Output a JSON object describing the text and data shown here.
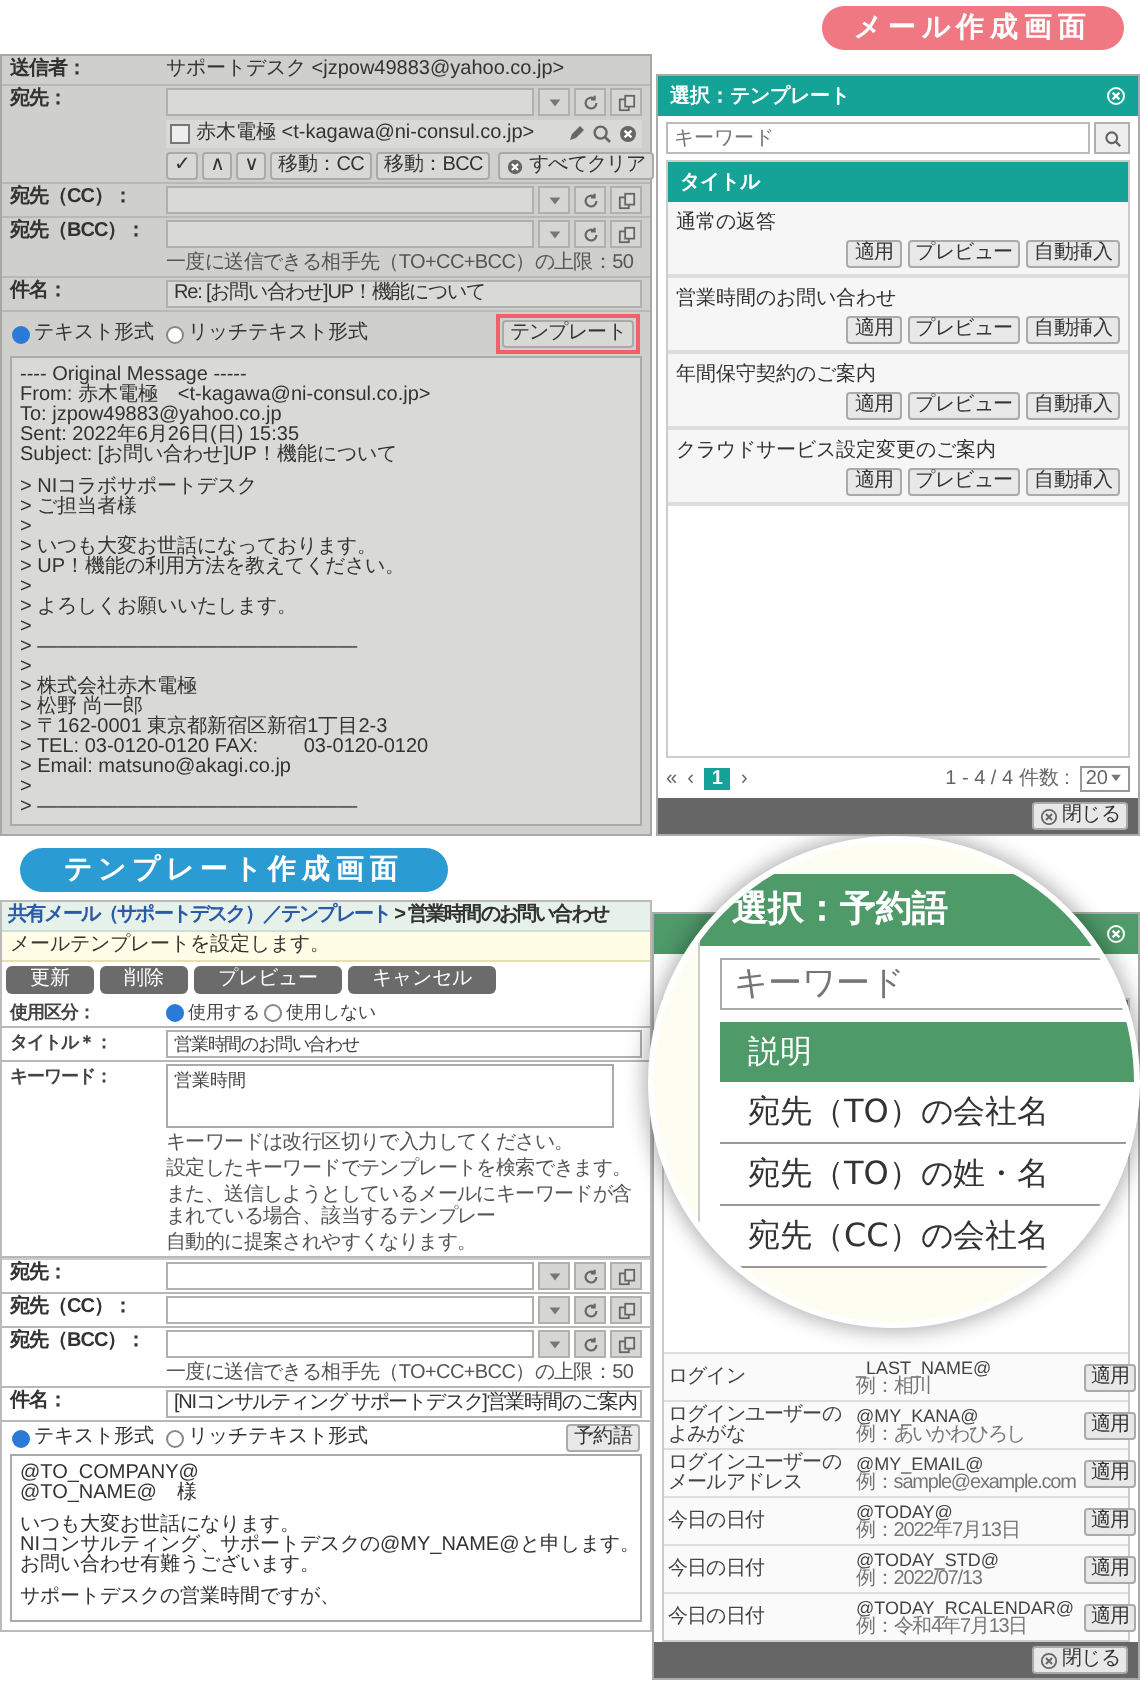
{
  "mail_screen": {
    "badge": "メール作成画面",
    "compose": {
      "sender_label": "送信者：",
      "sender": "サポートデスク <jzpow49883@yahoo.co.jp>",
      "to_label": "宛先：",
      "contact": {
        "checked": false,
        "text": "赤木電極 <t-kagawa@ni-consul.co.jp>"
      },
      "recipient_buttons": [
        "✓",
        "∧",
        "∨",
        "移動：CC",
        "移動：BCC"
      ],
      "clear_all": "すべてクリア",
      "cc_label": "宛先（CC）：",
      "bcc_label": "宛先（BCC）：",
      "limit_note": "一度に送信できる相手先（TO+CC+BCC）の上限：50",
      "subject_label": "件名：",
      "subject": "Re: [お問い合わせ]UP！機能について",
      "formats": [
        {
          "label": "テキスト形式",
          "selected": true
        },
        {
          "label": "リッチテキスト形式",
          "selected": false
        }
      ],
      "template_button": {
        "label": "テンプレート",
        "highlighted": true
      },
      "body": [
        [
          "---- Original Message -----",
          "From: 赤木電極　<t-kagawa@ni-consul.co.jp>",
          "To: jzpow49883@yahoo.co.jp",
          "Sent: 2022年6月26日(日) 15:35",
          "Subject: [お問い合わせ]UP！機能について"
        ],
        [
          "> NIコラボサポートデスク",
          "> ご担当者様",
          ">",
          "> いつも大変お世話になっております。",
          "> UP！機能の利用方法を教えてください。",
          ">",
          "> よろしくお願いいたします。",
          ">",
          "> ――――――――――――――――",
          ">",
          "> 株式会社赤木電極",
          "> 松野 尚一郎",
          "> 〒162-0001 東京都新宿区新宿1丁目2-3",
          "> TEL: 03-0120-0120 FAX:　　 03-0120-0120",
          "> Email: matsuno@akagi.co.jp",
          ">",
          "> ――――――――――――――――"
        ]
      ]
    },
    "template_dialog": {
      "title": "選択：テンプレート",
      "search_placeholder": "キーワード",
      "column": "タイトル",
      "rows": [
        {
          "title": "通常の返答",
          "actions": [
            "適用",
            "プレビュー",
            "自動挿入"
          ]
        },
        {
          "title": "営業時間のお問い合わせ",
          "actions": [
            "適用",
            "プレビュー",
            "自動挿入"
          ]
        },
        {
          "title": "年間保守契約のご案内",
          "actions": [
            "適用",
            "プレビュー",
            "自動挿入"
          ]
        },
        {
          "title": "クラウドサービス設定変更のご案内",
          "actions": [
            "適用",
            "プレビュー",
            "自動挿入"
          ]
        }
      ],
      "pager": {
        "first": "«",
        "prev": "‹",
        "pages": [
          {
            "label": "1",
            "selected": true
          }
        ],
        "next": "›",
        "summary": "1 - 4 / 4 件数 :",
        "per_page": "20"
      },
      "close": "閉じる"
    }
  },
  "template_screen": {
    "badge": "テンプレート作成画面",
    "form": {
      "breadcrumb_link": "共有メール（サポートデスク）／テンプレート",
      "breadcrumb_current": "> 営業時間のお問い合わせ",
      "description": "メールテンプレートを設定します。",
      "buttons": [
        "更新",
        "削除",
        "プレビュー",
        "キャンセル"
      ],
      "usage_label": "使用区分：",
      "usage_options": [
        {
          "label": "使用する",
          "selected": true
        },
        {
          "label": "使用しない",
          "selected": false
        }
      ],
      "title_label": "タイトル＊：",
      "title": "営業時間のお問い合わせ",
      "keyword_label": "キーワード：",
      "keyword": "営業時間",
      "keyword_notes": [
        "キーワードは改行区切りで入力してください。",
        "設定したキーワードでテンプレートを検索できます。",
        "また、送信しようとしているメールにキーワードが含まれている場合、該当するテンプレー",
        "自動的に提案されやすくなります。"
      ],
      "to_label": "宛先：",
      "cc_label": "宛先（CC）：",
      "bcc_label": "宛先（BCC）：",
      "limit_note": "一度に送信できる相手先（TO+CC+BCC）の上限：50",
      "subject_label": "件名：",
      "subject": "[NIコンサルティング サポートデスク]営業時間のご案内",
      "formats": [
        {
          "label": "テキスト形式",
          "selected": true
        },
        {
          "label": "リッチテキスト形式",
          "selected": false
        }
      ],
      "reserved_button": "予約語",
      "body": [
        [
          "@TO_COMPANY@",
          "@TO_NAME@　様"
        ],
        [
          "いつも大変お世話になります。",
          "NIコンサルティング、サポートデスクの@MY_NAME@と申します。",
          "お問い合わせ有難うございます。"
        ],
        [
          "サポートデスクの営業時間ですが、"
        ]
      ]
    },
    "reserved_dialog": {
      "rows": [
        {
          "description": "ログイン",
          "word": "_LAST_NAME@",
          "example": "例：相川",
          "button": "適用"
        },
        {
          "description": "ログインユーザーのよみがな",
          "word": "@MY_KANA@",
          "example": "例：あいかわひろし",
          "button": "適用"
        },
        {
          "description": "ログインユーザーのメールアドレス",
          "word": "@MY_EMAIL@",
          "example": "例：sample@example.com",
          "button": "適用"
        },
        {
          "description": "今日の日付",
          "word": "@TODAY@",
          "example": "例：2022年7月13日",
          "button": "適用"
        },
        {
          "description": "今日の日付",
          "word": "@TODAY_STD@",
          "example": "例：2022/07/13",
          "button": "適用"
        },
        {
          "description": "今日の日付",
          "word": "@TODAY_RCALENDAR@",
          "example": "例：令和4年7月13日",
          "button": "適用"
        }
      ],
      "close": "閉じる"
    },
    "magnifier": {
      "title": "選択：予約語",
      "search_placeholder": "キーワード",
      "column": "説明",
      "rows": [
        "宛先（TO）の会社名",
        "宛先（TO）の姓・名",
        "宛先（CC）の会社名"
      ]
    }
  }
}
